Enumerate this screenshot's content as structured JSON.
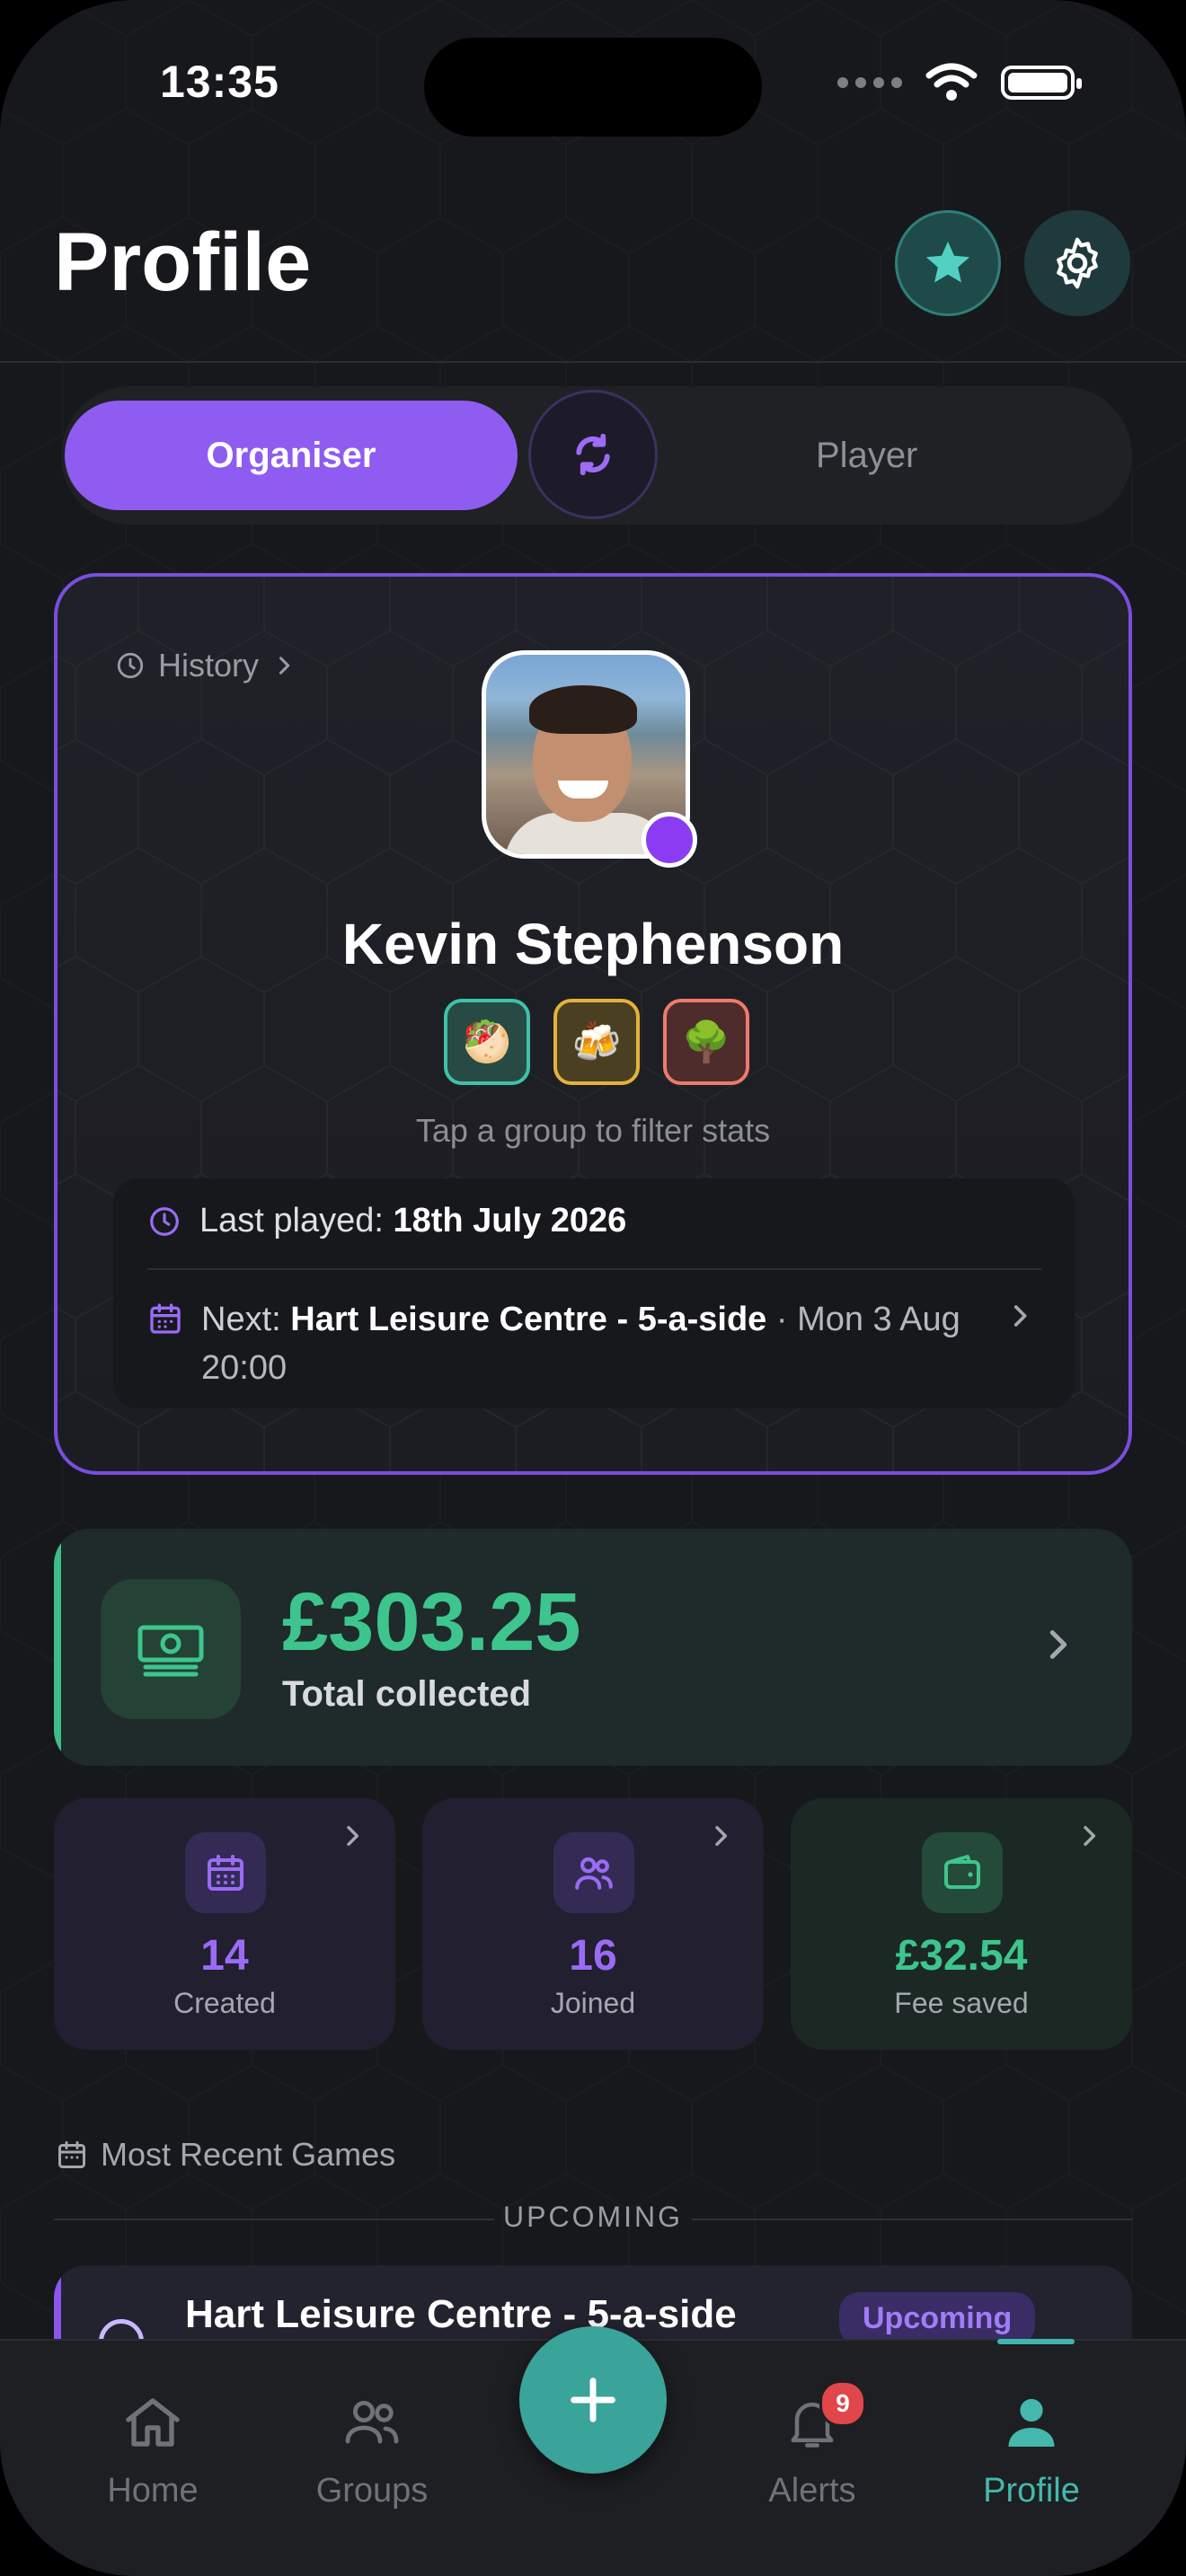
{
  "status_bar": {
    "time": "13:35"
  },
  "header": {
    "title": "Profile"
  },
  "segmented": {
    "left": "Organiser",
    "right": "Player",
    "selected": "Organiser"
  },
  "profile": {
    "history_label": "History",
    "name": "Kevin Stephenson",
    "groups": [
      "🥙",
      "🍻",
      "🌳"
    ],
    "hint": "Tap a group to filter stats",
    "last_played_label": "Last played: ",
    "last_played_value": "18th July 2026",
    "next_label": "Next: ",
    "next_venue": "Hart Leisure Centre - 5-a-side",
    "next_when": " · Mon 3 Aug 20:00"
  },
  "total": {
    "value": "£303.25",
    "label": "Total collected"
  },
  "stats": [
    {
      "value": "14",
      "label": "Created",
      "icon": "calendar-icon"
    },
    {
      "value": "16",
      "label": "Joined",
      "icon": "people-icon"
    },
    {
      "value": "£32.54",
      "label": "Fee saved",
      "icon": "wallet-icon"
    }
  ],
  "recent": {
    "heading": "Most Recent Games",
    "section": "UPCOMING",
    "game_title": "Hart Leisure Centre - 5-a-side",
    "game_badge": "Upcoming"
  },
  "tabbar": {
    "home": "Home",
    "groups": "Groups",
    "alerts": "Alerts",
    "alerts_badge": "9",
    "profile": "Profile"
  },
  "colors": {
    "accent_purple": "#8e5cf0",
    "accent_teal": "#3aa39a",
    "money_green": "#3dc58d"
  }
}
